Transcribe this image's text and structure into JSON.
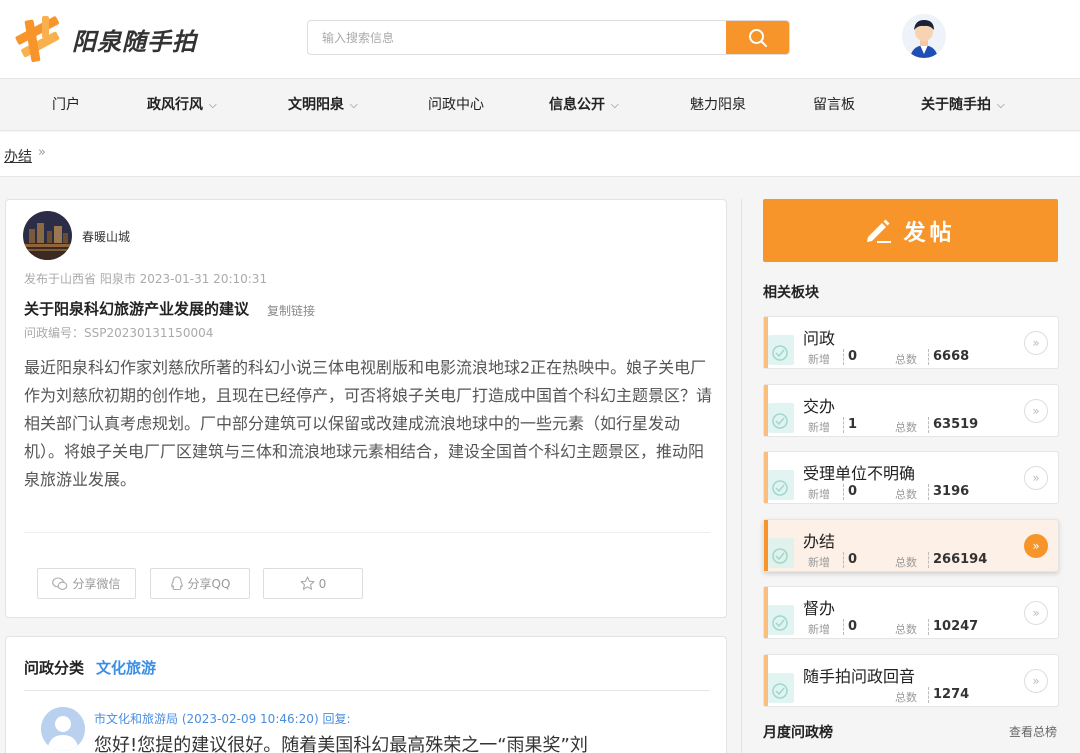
{
  "header": {
    "logo_text": "阳泉随手拍",
    "search_placeholder": "输入搜索信息"
  },
  "nav": [
    {
      "label": "门户",
      "dropdown": false,
      "bold": false
    },
    {
      "label": "政风行风",
      "dropdown": true,
      "bold": true
    },
    {
      "label": "文明阳泉",
      "dropdown": true,
      "bold": true
    },
    {
      "label": "问政中心",
      "dropdown": false,
      "bold": false
    },
    {
      "label": "信息公开",
      "dropdown": true,
      "bold": true
    },
    {
      "label": "魅力阳泉",
      "dropdown": false,
      "bold": false
    },
    {
      "label": "留言板",
      "dropdown": false,
      "bold": false
    },
    {
      "label": "关于随手拍",
      "dropdown": true,
      "bold": true
    }
  ],
  "breadcrumb": {
    "current": "办结",
    "separator": "»"
  },
  "post": {
    "user": "春暖山城",
    "meta": "发布于山西省 阳泉市 2023-01-31 20:10:31",
    "title": "关于阳泉科幻旅游产业发展的建议",
    "copy_link": "复制链接",
    "code": "问政编号：SSP20230131150004",
    "body": "最近阳泉科幻作家刘慈欣所著的科幻小说三体电视剧版和电影流浪地球2正在热映中。娘子关电厂作为刘慈欣初期的创作地，且现在已经停产，可否将娘子关电厂打造成中国首个科幻主题景区？请相关部门认真考虑规划。厂中部分建筑可以保留或改建成流浪地球中的一些元素（如行星发动机）。将娘子关电厂厂区建筑与三体和流浪地球元素相结合，建设全国首个科幻主题景区，推动阳泉旅游业发展。",
    "share_wechat": "分享微信",
    "share_qq": "分享QQ",
    "like_count": "0"
  },
  "category": {
    "label": "问政分类",
    "value": "文化旅游"
  },
  "reply": {
    "meta": "市文化和旅游局  (2023-02-09 10:46:20) 回复:",
    "text": "您好!您提的建议很好。随着美国科幻最高殊荣之一“雨果奖”刘"
  },
  "sidebar": {
    "post_button": "发帖",
    "section_title": "相关板块",
    "new_label": "新增",
    "total_label": "总数",
    "items": [
      {
        "name": "问政",
        "new": "0",
        "total": "6668",
        "show_new": true,
        "active": false
      },
      {
        "name": "交办",
        "new": "1",
        "total": "63519",
        "show_new": true,
        "active": false
      },
      {
        "name": "受理单位不明确",
        "new": "0",
        "total": "3196",
        "show_new": true,
        "active": false
      },
      {
        "name": "办结",
        "new": "0",
        "total": "266194",
        "show_new": true,
        "active": true
      },
      {
        "name": "督办",
        "new": "0",
        "total": "10247",
        "show_new": true,
        "active": false
      },
      {
        "name": "随手拍问政回音",
        "new": "",
        "total": "1274",
        "show_new": false,
        "active": false
      }
    ],
    "monthly_title": "月度问政榜",
    "monthly_more": "查看总榜"
  },
  "colors": {
    "accent": "#f7952a",
    "link": "#3a8ee6"
  }
}
